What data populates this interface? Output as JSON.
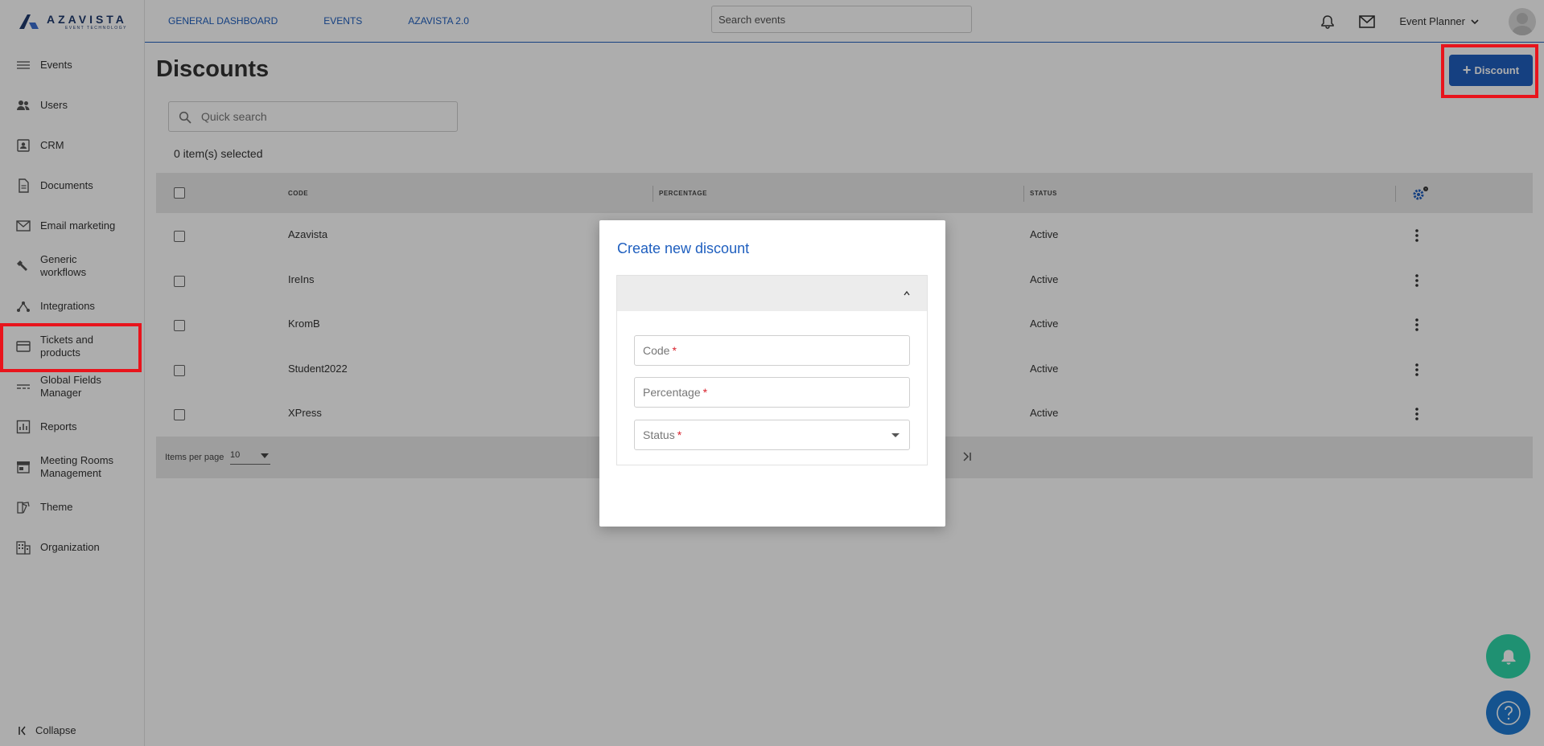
{
  "brand": {
    "name": "AZAVISTA",
    "tagline": "EVENT TECHNOLOGY"
  },
  "sidebar": {
    "items": [
      {
        "label": "Events",
        "icon": "list-icon"
      },
      {
        "label": "Users",
        "icon": "users-icon"
      },
      {
        "label": "CRM",
        "icon": "contact-card-icon"
      },
      {
        "label": "Documents",
        "icon": "document-icon"
      },
      {
        "label": "Email marketing",
        "icon": "mail-icon"
      },
      {
        "label": "Generic workflows",
        "icon": "wrench-icon"
      },
      {
        "label": "Integrations",
        "icon": "integration-icon"
      },
      {
        "label": "Tickets and products",
        "icon": "card-icon"
      },
      {
        "label": "Global Fields Manager",
        "icon": "fields-icon"
      },
      {
        "label": "Reports",
        "icon": "chart-icon"
      },
      {
        "label": "Meeting Rooms Management",
        "icon": "store-icon"
      },
      {
        "label": "Theme",
        "icon": "palette-icon"
      },
      {
        "label": "Organization",
        "icon": "building-icon"
      }
    ],
    "collapse_label": "Collapse"
  },
  "topbar": {
    "links": [
      "GENERAL DASHBOARD",
      "EVENTS",
      "AZAVISTA 2.0"
    ],
    "search_placeholder": "Search events",
    "user_menu": "Event Planner"
  },
  "page": {
    "title": "Discounts",
    "add_button": "Discount",
    "quick_search_placeholder": "Quick search",
    "selected_text": "0 item(s) selected"
  },
  "table": {
    "columns": [
      "CODE",
      "PERCENTAGE",
      "STATUS"
    ],
    "rows": [
      {
        "code": "Azavista",
        "status": "Active"
      },
      {
        "code": "IreIns",
        "status": "Active"
      },
      {
        "code": "KromB",
        "status": "Active"
      },
      {
        "code": "Student2022",
        "status": "Active"
      },
      {
        "code": "XPress",
        "status": "Active"
      }
    ],
    "items_per_page_label": "Items per page",
    "items_per_page_value": "10"
  },
  "modal": {
    "title": "Create new discount",
    "fields": [
      {
        "label": "Code",
        "required_mark": "*"
      },
      {
        "label": "Percentage",
        "required_mark": "*"
      },
      {
        "label": "Status",
        "required_mark": "*"
      }
    ]
  },
  "colors": {
    "accent": "#1f5fbf",
    "highlight": "#e8141c",
    "fab_bell": "#2fd6a8",
    "fab_help": "#1f7bd3"
  }
}
